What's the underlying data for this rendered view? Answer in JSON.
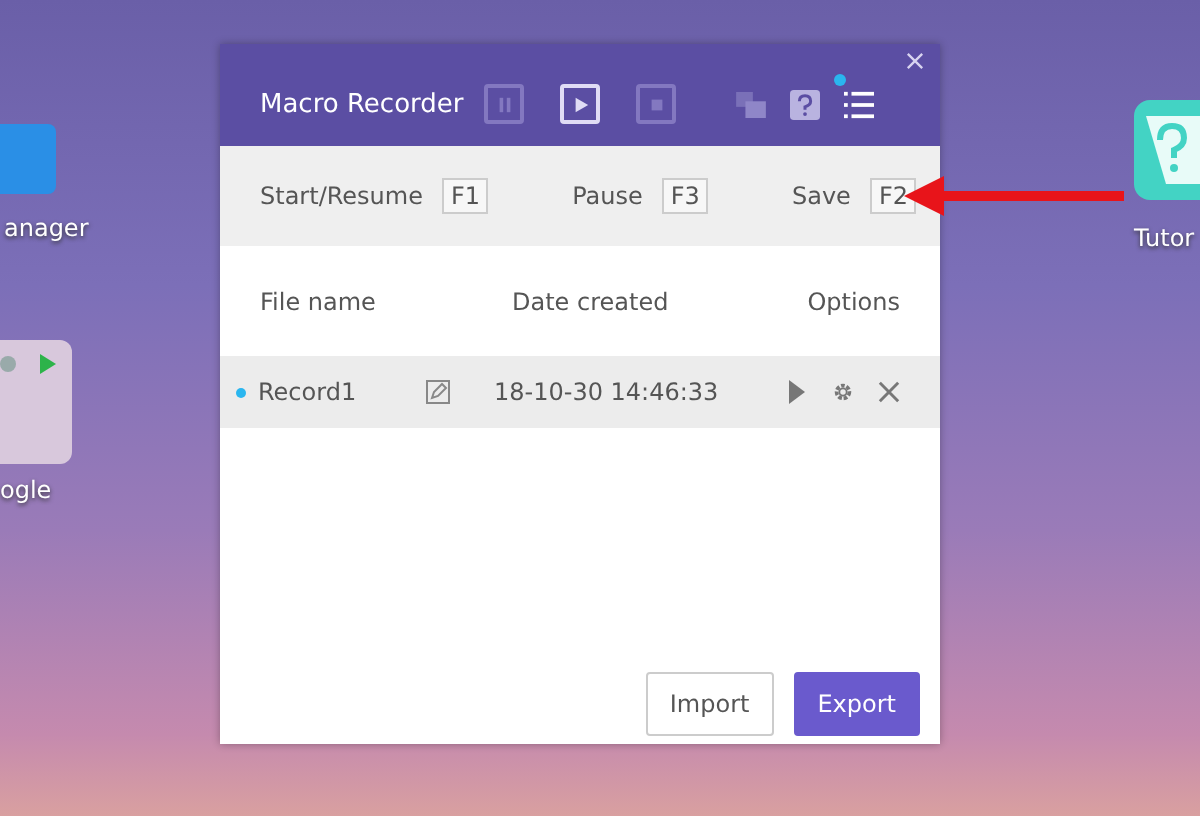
{
  "desktop": {
    "icons": [
      {
        "kind": "manager",
        "label": "anager"
      },
      {
        "kind": "google",
        "label": "ogle"
      },
      {
        "kind": "tutorial",
        "label": "Tutor"
      }
    ]
  },
  "window": {
    "title": "Macro Recorder",
    "notification": true,
    "controls": [
      {
        "kind": "pause",
        "disabled": true
      },
      {
        "kind": "play",
        "disabled": false
      },
      {
        "kind": "stop",
        "disabled": true
      }
    ]
  },
  "shortcuts": [
    {
      "label": "Start/Resume",
      "key": "F1"
    },
    {
      "label": "Pause",
      "key": "F3"
    },
    {
      "label": "Save",
      "key": "F2"
    }
  ],
  "table": {
    "columns": [
      "File name",
      "Date created",
      "Options"
    ],
    "rows": [
      {
        "name": "Record1",
        "date": "18-10-30 14:46:33",
        "selected": true
      }
    ]
  },
  "buttons": [
    {
      "label": "Import",
      "kind": "secondary"
    },
    {
      "label": "Export",
      "kind": "primary"
    }
  ]
}
